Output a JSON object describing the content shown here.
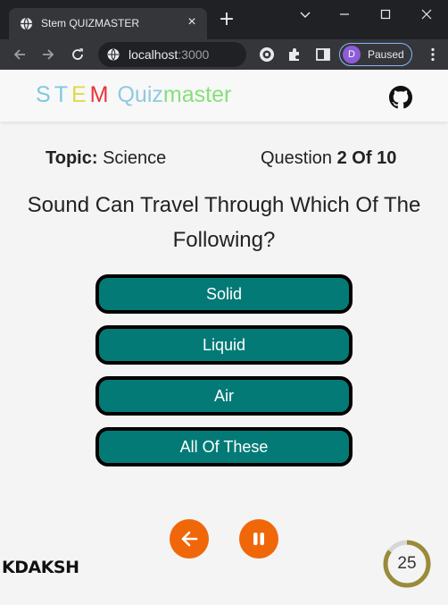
{
  "browser": {
    "tab_title": "Stem QUIZMASTER",
    "url_host": "localhost",
    "url_port": ":3000",
    "profile_initial": "D",
    "profile_status": "Paused"
  },
  "app": {
    "logo_letters": [
      "S",
      "T",
      "E",
      "M"
    ],
    "logo_quiz": "Quiz",
    "logo_master": "master",
    "github_icon": "github-icon"
  },
  "quiz": {
    "topic_label": "Topic:",
    "topic_value": "Science",
    "question_prefix": "Question",
    "question_counter": "2 Of 10",
    "question_text": "Sound Can Travel Through Which Of The Following?",
    "options": [
      "Solid",
      "Liquid",
      "Air",
      "All Of These"
    ]
  },
  "controls": {
    "back_icon": "arrow-left-icon",
    "pause_icon": "pause-icon"
  },
  "footer": {
    "watermark": "KDAKSH",
    "timer_value": "25",
    "timer_progress": 0.85
  },
  "colors": {
    "option_bg": "#047a77",
    "control_bg": "#f0670a",
    "timer_ring": "#9a8b3a"
  }
}
